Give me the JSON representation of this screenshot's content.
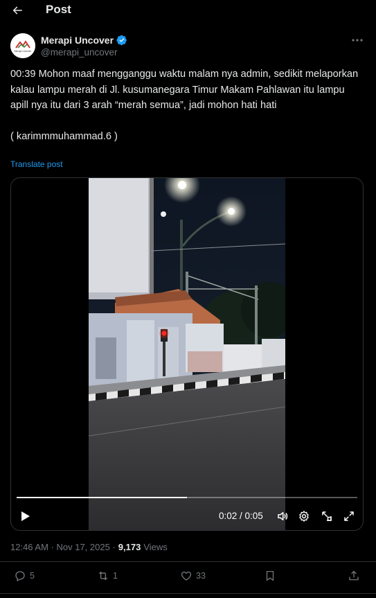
{
  "header": {
    "title": "Post"
  },
  "author": {
    "name": "Merapi Uncover",
    "handle": "@merapi_uncover",
    "avatar_caption": "Merapi Uncover"
  },
  "post": {
    "text": "00:39 Mohon maaf mengganggu waktu malam nya admin, sedikit melaporkan kalau lampu merah di Jl. kusumanegara Timur Makam Pahlawan itu lampu apill nya itu dari 3 arah “merah semua”, jadi mohon hati hati\n\n( karimmmuhammad.6 )",
    "translate_label": "Translate post"
  },
  "video": {
    "time": "0:02 / 0:05",
    "progress": 0.5
  },
  "meta": {
    "timestamp": "12:46 AM · Nov 17, 2025 ·",
    "views_count": "9,173",
    "views_label": "Views"
  },
  "actions": {
    "replies": "5",
    "reposts": "1",
    "likes": "33"
  },
  "colors": {
    "accent": "#1d9bf0",
    "muted": "#71767b",
    "border": "#2f3336"
  }
}
